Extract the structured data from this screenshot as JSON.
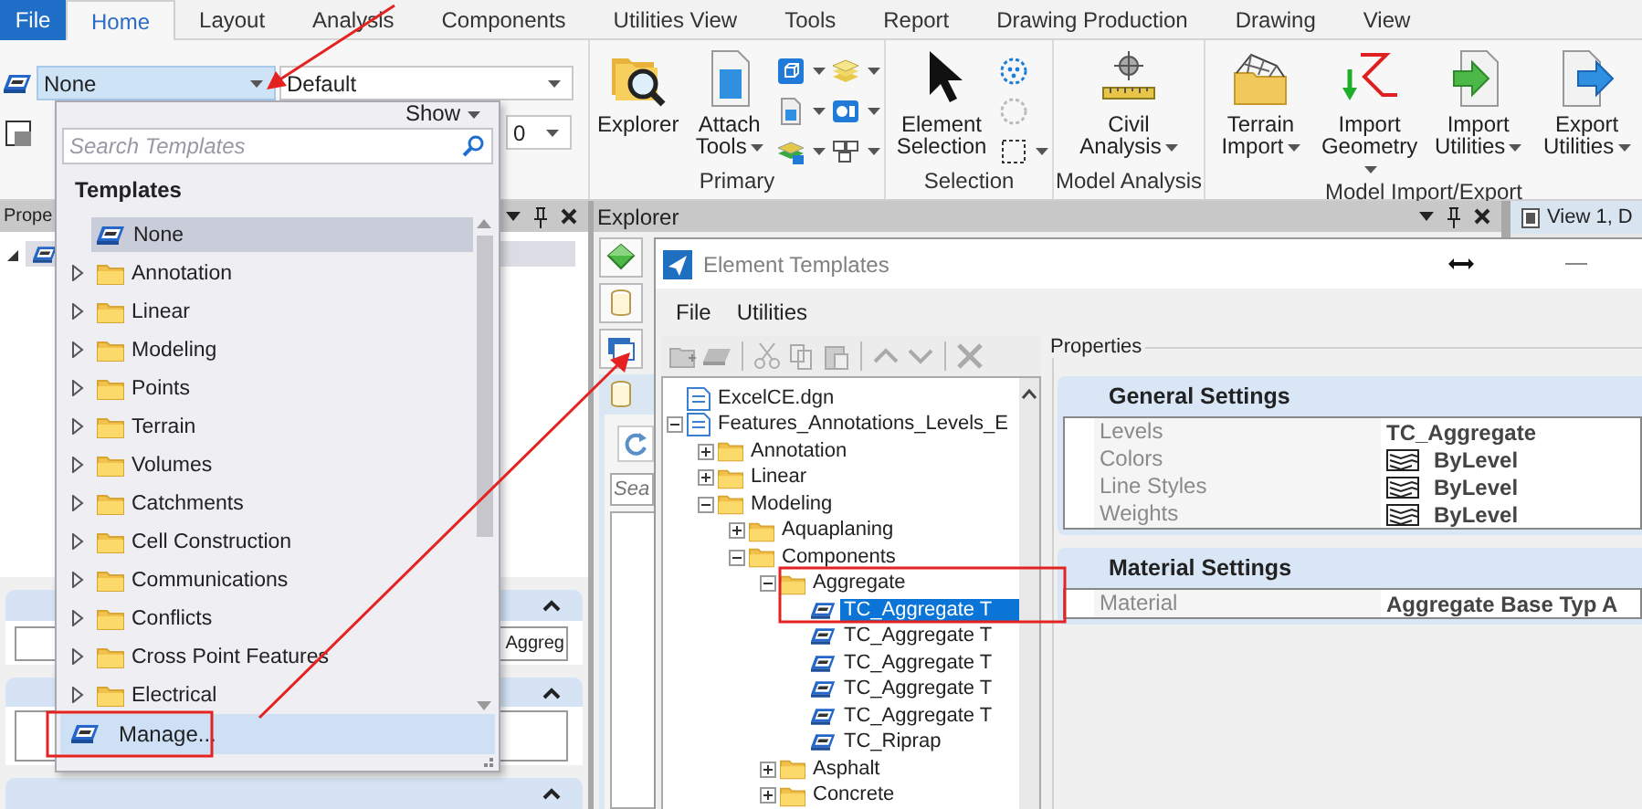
{
  "ribbon_tabs": [
    {
      "label": "File",
      "kind": "backstage",
      "selected": false
    },
    {
      "label": "Home",
      "kind": "tab",
      "selected": true
    },
    {
      "label": "Layout",
      "kind": "tab",
      "selected": false
    },
    {
      "label": "Analysis",
      "kind": "tab",
      "selected": false
    },
    {
      "label": "Components",
      "kind": "tab",
      "selected": false
    },
    {
      "label": "Utilities View",
      "kind": "tab",
      "selected": false
    },
    {
      "label": "Tools",
      "kind": "tab",
      "selected": false
    },
    {
      "label": "Report",
      "kind": "tab",
      "selected": false
    },
    {
      "label": "Drawing Production",
      "kind": "tab",
      "selected": false
    },
    {
      "label": "Drawing",
      "kind": "tab",
      "selected": false
    },
    {
      "label": "View",
      "kind": "tab",
      "selected": false
    }
  ],
  "ribbon": {
    "attribute_bar": {
      "template": "None",
      "level": "Default",
      "second_row_value": "0"
    },
    "groups": [
      {
        "label": "Primary",
        "kind": "primary",
        "buttons": [
          {
            "label": "Explorer",
            "kind": "explorer",
            "dropdown": false
          },
          {
            "label": "Attach Tools",
            "kind": "attach",
            "dropdown": true
          }
        ]
      },
      {
        "label": "Selection",
        "kind": "selection",
        "buttons": [
          {
            "label": "Element Selection",
            "kind": "select",
            "dropdown": false
          }
        ]
      },
      {
        "label": "Model Analysis",
        "kind": "analysis",
        "buttons": [
          {
            "label": "Civil Analysis",
            "kind": "civil",
            "dropdown": true
          }
        ]
      },
      {
        "label": "Model Import/Export",
        "kind": "import_export",
        "buttons": [
          {
            "label": "Terrain Import",
            "kind": "terrain",
            "dropdown": true
          },
          {
            "label": "Import Geometry",
            "kind": "geometry",
            "dropdown": true
          },
          {
            "label": "Import Utilities",
            "kind": "import",
            "dropdown": true
          },
          {
            "label": "Export Utilities",
            "kind": "export",
            "dropdown": true
          }
        ]
      }
    ]
  },
  "properties_panel": {
    "title": "Prope",
    "field_value": "Aggreg"
  },
  "explorer_panel": {
    "title": "Explorer",
    "search": {
      "placeholder": "Sea"
    }
  },
  "view_tab": {
    "label": "View 1, D"
  },
  "template_picker": {
    "show_label": "Show",
    "search": {
      "placeholder": "Search Templates"
    },
    "heading": "Templates",
    "items": [
      {
        "label": "None",
        "kind": "template",
        "selected": true
      },
      {
        "label": "Annotation",
        "kind": "folder",
        "selected": false,
        "expanded": false
      },
      {
        "label": "Linear",
        "kind": "folder",
        "selected": false,
        "expanded": false
      },
      {
        "label": "Modeling",
        "kind": "folder",
        "selected": false,
        "expanded": false
      },
      {
        "label": "Points",
        "kind": "folder",
        "selected": false,
        "expanded": false
      },
      {
        "label": "Terrain",
        "kind": "folder",
        "selected": false,
        "expanded": false
      },
      {
        "label": "Volumes",
        "kind": "folder",
        "selected": false,
        "expanded": false
      },
      {
        "label": "Catchments",
        "kind": "folder",
        "selected": false,
        "expanded": false
      },
      {
        "label": "Cell Construction",
        "kind": "folder",
        "selected": false,
        "expanded": false
      },
      {
        "label": "Communications",
        "kind": "folder",
        "selected": false,
        "expanded": false
      },
      {
        "label": "Conflicts",
        "kind": "folder",
        "selected": false,
        "expanded": false
      },
      {
        "label": "Cross Point Features",
        "kind": "folder",
        "selected": false,
        "expanded": false
      },
      {
        "label": "Electrical",
        "kind": "folder",
        "selected": false,
        "expanded": false
      }
    ],
    "manage_label": "Manage..."
  },
  "element_templates_dialog": {
    "title": "Element Templates",
    "menu": [
      "File",
      "Utilities"
    ],
    "tree": [
      {
        "label": "ExcelCE.dgn",
        "kind": "file",
        "selected": false
      },
      {
        "label": "Features_Annotations_Levels_E",
        "kind": "file",
        "selected": false,
        "expanded": true,
        "children": [
          {
            "label": "Annotation",
            "kind": "folder",
            "selected": false,
            "expanded": false
          },
          {
            "label": "Linear",
            "kind": "folder",
            "selected": false,
            "expanded": false
          },
          {
            "label": "Modeling",
            "kind": "folder",
            "selected": false,
            "expanded": true,
            "children": [
              {
                "label": "Aquaplaning",
                "kind": "folder",
                "selected": false,
                "expanded": false
              },
              {
                "label": "Components",
                "kind": "folder",
                "selected": false,
                "expanded": true,
                "children": [
                  {
                    "label": "Aggregate",
                    "kind": "folder",
                    "selected": false,
                    "expanded": true,
                    "children": [
                      {
                        "label": "TC_Aggregate T",
                        "kind": "template",
                        "selected": true
                      },
                      {
                        "label": "TC_Aggregate T",
                        "kind": "template",
                        "selected": false
                      },
                      {
                        "label": "TC_Aggregate T",
                        "kind": "template",
                        "selected": false
                      },
                      {
                        "label": "TC_Aggregate T",
                        "kind": "template",
                        "selected": false
                      },
                      {
                        "label": "TC_Aggregate T",
                        "kind": "template",
                        "selected": false
                      },
                      {
                        "label": "TC_Riprap",
                        "kind": "template",
                        "selected": false
                      }
                    ]
                  },
                  {
                    "label": "Asphalt",
                    "kind": "folder",
                    "selected": false,
                    "expanded": false
                  },
                  {
                    "label": "Concrete",
                    "kind": "folder",
                    "selected": false,
                    "expanded": false
                  }
                ]
              }
            ]
          }
        ]
      }
    ],
    "properties": {
      "title": "Properties",
      "sections": [
        {
          "title": "General Settings",
          "rows": [
            {
              "label": "Levels",
              "value": "TC_Aggregate",
              "swatch": false
            },
            {
              "label": "Colors",
              "value": "ByLevel",
              "swatch": true
            },
            {
              "label": "Line Styles",
              "value": "ByLevel",
              "swatch": true
            },
            {
              "label": "Weights",
              "value": "ByLevel",
              "swatch": true
            }
          ]
        },
        {
          "title": "Material Settings",
          "rows": [
            {
              "label": "Material",
              "value": "Aggregate Base Typ A",
              "swatch": false
            }
          ]
        }
      ]
    }
  }
}
